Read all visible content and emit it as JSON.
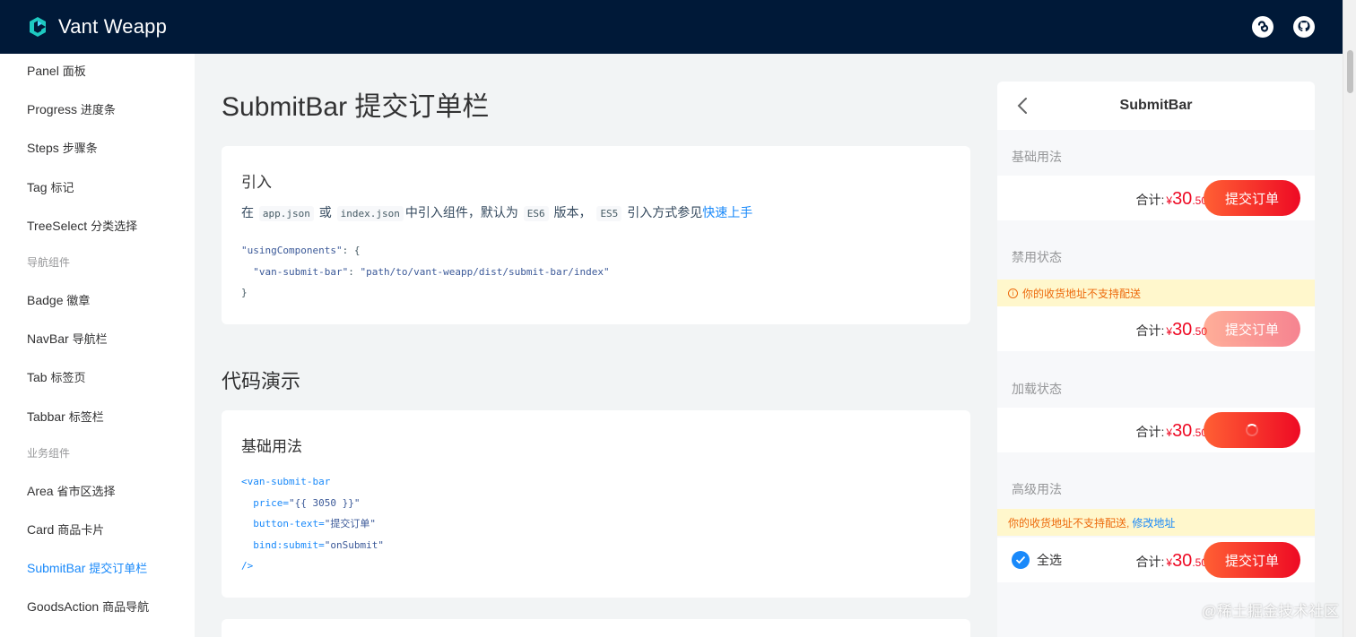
{
  "header": {
    "title": "Vant Weapp"
  },
  "sidebar": {
    "items": [
      {
        "en": "Panel",
        "cn": "面板"
      },
      {
        "en": "Progress",
        "cn": "进度条"
      },
      {
        "en": "Steps",
        "cn": "步骤条"
      },
      {
        "en": "Tag",
        "cn": "标记"
      },
      {
        "en": "TreeSelect",
        "cn": "分类选择"
      },
      {
        "group": "导航组件"
      },
      {
        "en": "Badge",
        "cn": "徽章"
      },
      {
        "en": "NavBar",
        "cn": "导航栏"
      },
      {
        "en": "Tab",
        "cn": "标签页"
      },
      {
        "en": "Tabbar",
        "cn": "标签栏"
      },
      {
        "group": "业务组件"
      },
      {
        "en": "Area",
        "cn": "省市区选择"
      },
      {
        "en": "Card",
        "cn": "商品卡片"
      },
      {
        "en": "SubmitBar",
        "cn": "提交订单栏",
        "active": true
      },
      {
        "en": "GoodsAction",
        "cn": "商品导航"
      }
    ]
  },
  "main": {
    "title": "SubmitBar 提交订单栏",
    "intro": {
      "heading": "引入",
      "t1": "在",
      "c1": "app.json",
      "t2": "或",
      "c2": "index.json",
      "t3": "中引入组件，默认为",
      "c3": "ES6",
      "t4": "版本，",
      "c4": "ES5",
      "t5": "引入方式参见",
      "link": "快速上手",
      "code": {
        "l1a": "\"usingComponents\"",
        "l1b": ": {",
        "l2a": "  \"van-submit-bar\"",
        "l2b": ": ",
        "l2c": "\"path/to/vant-weapp/dist/submit-bar/index\"",
        "l3": "}"
      }
    },
    "demo_section": "代码演示",
    "basic": {
      "heading": "基础用法",
      "code": {
        "l1": "<van-submit-bar",
        "l2a": "  price=",
        "l2b": "\"{{ 3050 }}\"",
        "l3a": "  button-text=",
        "l3b": "\"提交订单\"",
        "l4a": "  bind:submit=",
        "l4b": "\"onSubmit\"",
        "l5": "/>"
      }
    }
  },
  "phone": {
    "title": "SubmitBar",
    "demos": [
      {
        "title": "基础用法",
        "total_label": "合计:",
        "currency": "¥",
        "integer": "30",
        "decimal": ".50",
        "button": "提交订单"
      },
      {
        "title": "禁用状态",
        "tip": "你的收货地址不支持配送",
        "total_label": "合计:",
        "currency": "¥",
        "integer": "30",
        "decimal": ".50",
        "button": "提交订单"
      },
      {
        "title": "加载状态",
        "total_label": "合计:",
        "currency": "¥",
        "integer": "30",
        "decimal": ".50"
      },
      {
        "title": "高级用法",
        "tip": "你的收货地址不支持配送,",
        "tip_link": "修改地址",
        "checkbox_label": "全选",
        "total_label": "合计:",
        "currency": "¥",
        "integer": "30",
        "decimal": ".50",
        "button": "提交订单"
      }
    ]
  },
  "watermark": "@稀土掘金技术社区",
  "colors": {
    "header_bg": "#001938",
    "accent": "#1989fa",
    "danger": "#ee0a24",
    "notice_bg": "#fff7cc"
  }
}
